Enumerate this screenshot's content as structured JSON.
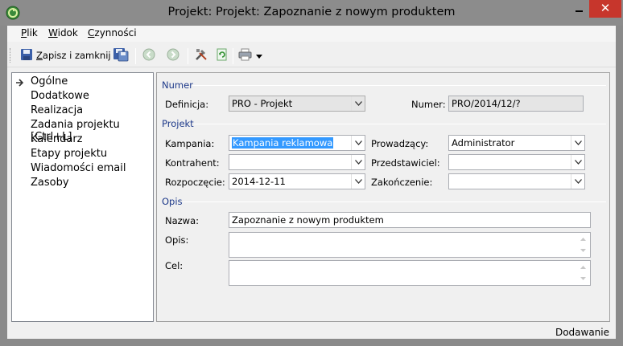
{
  "window": {
    "title": "Projekt: Projekt: Zapoznanie z nowym produktem",
    "close_label": "✕"
  },
  "menu": {
    "items": [
      {
        "underlined": "P",
        "rest": "lik"
      },
      {
        "underlined": "W",
        "rest": "idok"
      },
      {
        "underlined": "C",
        "rest": "zynności"
      }
    ]
  },
  "toolbar": {
    "save_close_underlined": "Z",
    "save_close_rest": "apisz i zamknij"
  },
  "nav": {
    "items": [
      "Ogólne",
      "Dodatkowe",
      "Realizacja",
      "Zadania projektu [Ctrl+L]",
      "Kalendarz",
      "Etapy projektu",
      "Wiadomości email",
      "Zasoby"
    ],
    "selected_index": 0
  },
  "form": {
    "sections": {
      "numer": "Numer",
      "projekt": "Projekt",
      "opis": "Opis"
    },
    "definicja": {
      "label": "Definicja:",
      "value": "PRO - Projekt"
    },
    "numer": {
      "label": "Numer:",
      "value": "PRO/2014/12/?"
    },
    "kampania": {
      "label": "Kampania:",
      "value": "Kampania reklamowa"
    },
    "prowadzacy": {
      "label": "Prowadzący:",
      "value": "Administrator"
    },
    "kontrahent": {
      "label": "Kontrahent:",
      "value": ""
    },
    "przedstawiciel": {
      "label": "Przedstawiciel:",
      "value": ""
    },
    "rozpoczecie": {
      "label": "Rozpoczęcie:",
      "value": "2014-12-11"
    },
    "zakonczenie": {
      "label": "Zakończenie:",
      "value": ""
    },
    "nazwa": {
      "label": "Nazwa:",
      "value": "Zapoznanie z nowym produktem"
    },
    "opis": {
      "label": "Opis:",
      "value": ""
    },
    "cel": {
      "label": "Cel:",
      "value": ""
    }
  },
  "status": {
    "mode": "Dodawanie"
  }
}
